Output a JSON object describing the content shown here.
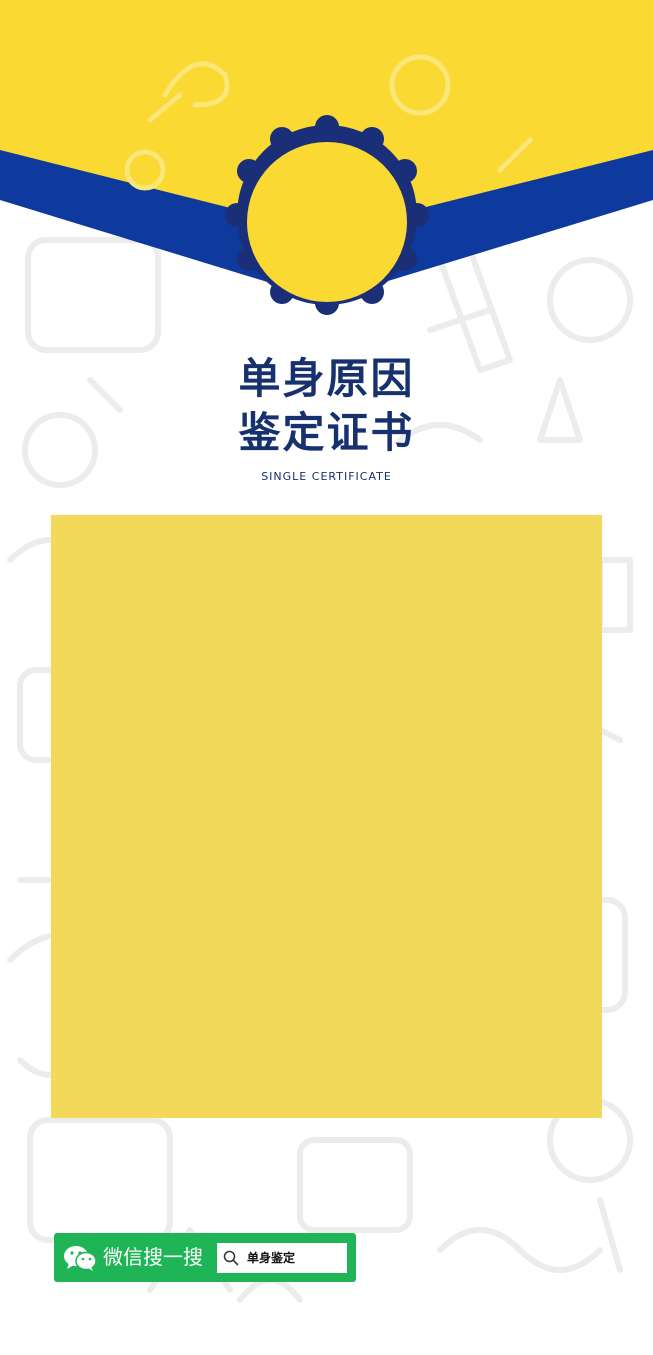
{
  "certificate": {
    "title_line1": "单身原因",
    "title_line2": "鉴定证书",
    "subtitle": "SINGLE CERTIFICATE"
  },
  "wechat_search": {
    "label": "微信搜一搜",
    "search_term": "单身鉴定"
  },
  "colors": {
    "header_yellow": "#f9d932",
    "ribbon_blue": "#0d3a9c",
    "badge_navy": "#1a2f78",
    "title_navy": "#17306e",
    "panel_yellow": "#f1d752",
    "wechat_green": "#1fb556"
  },
  "icons": [
    "wechat-icon",
    "search-icon"
  ]
}
